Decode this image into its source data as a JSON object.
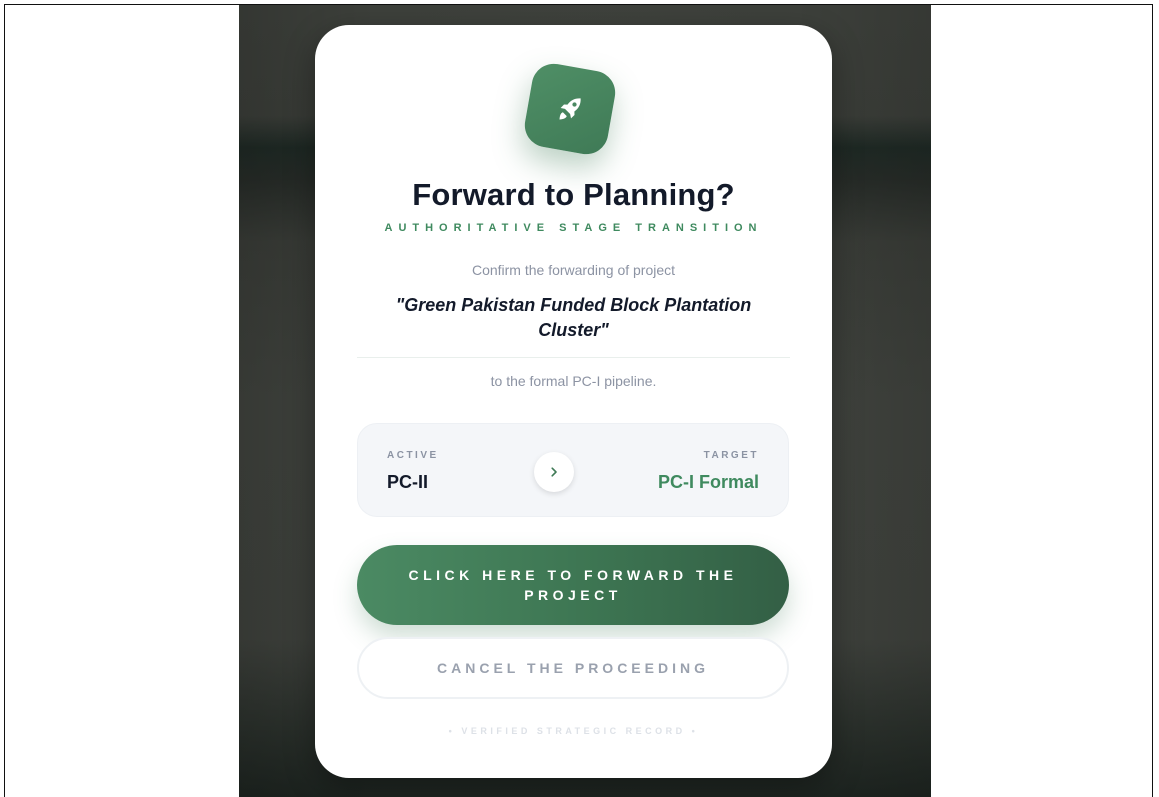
{
  "dialog": {
    "title": "Forward to Planning?",
    "subtitle": "AUTHORITATIVE STAGE TRANSITION",
    "confirm_text": "Confirm the forwarding of project",
    "project_name": "\"Green Pakistan Funded Block Plantation Cluster\"",
    "pipeline_text": "to the formal PC-I pipeline.",
    "icon": "rocket-icon",
    "accent_color": "#3f8a5f"
  },
  "stages": {
    "active_label": "ACTIVE",
    "active_value": "PC-II",
    "target_label": "TARGET",
    "target_value": "PC-I Formal",
    "arrow_icon": "chevron-right-icon"
  },
  "actions": {
    "forward_label": "CLICK HERE TO FORWARD THE PROJECT",
    "cancel_label": "CANCEL THE PROCEEDING"
  },
  "footer": {
    "note": "• VERIFIED STRATEGIC RECORD •"
  }
}
